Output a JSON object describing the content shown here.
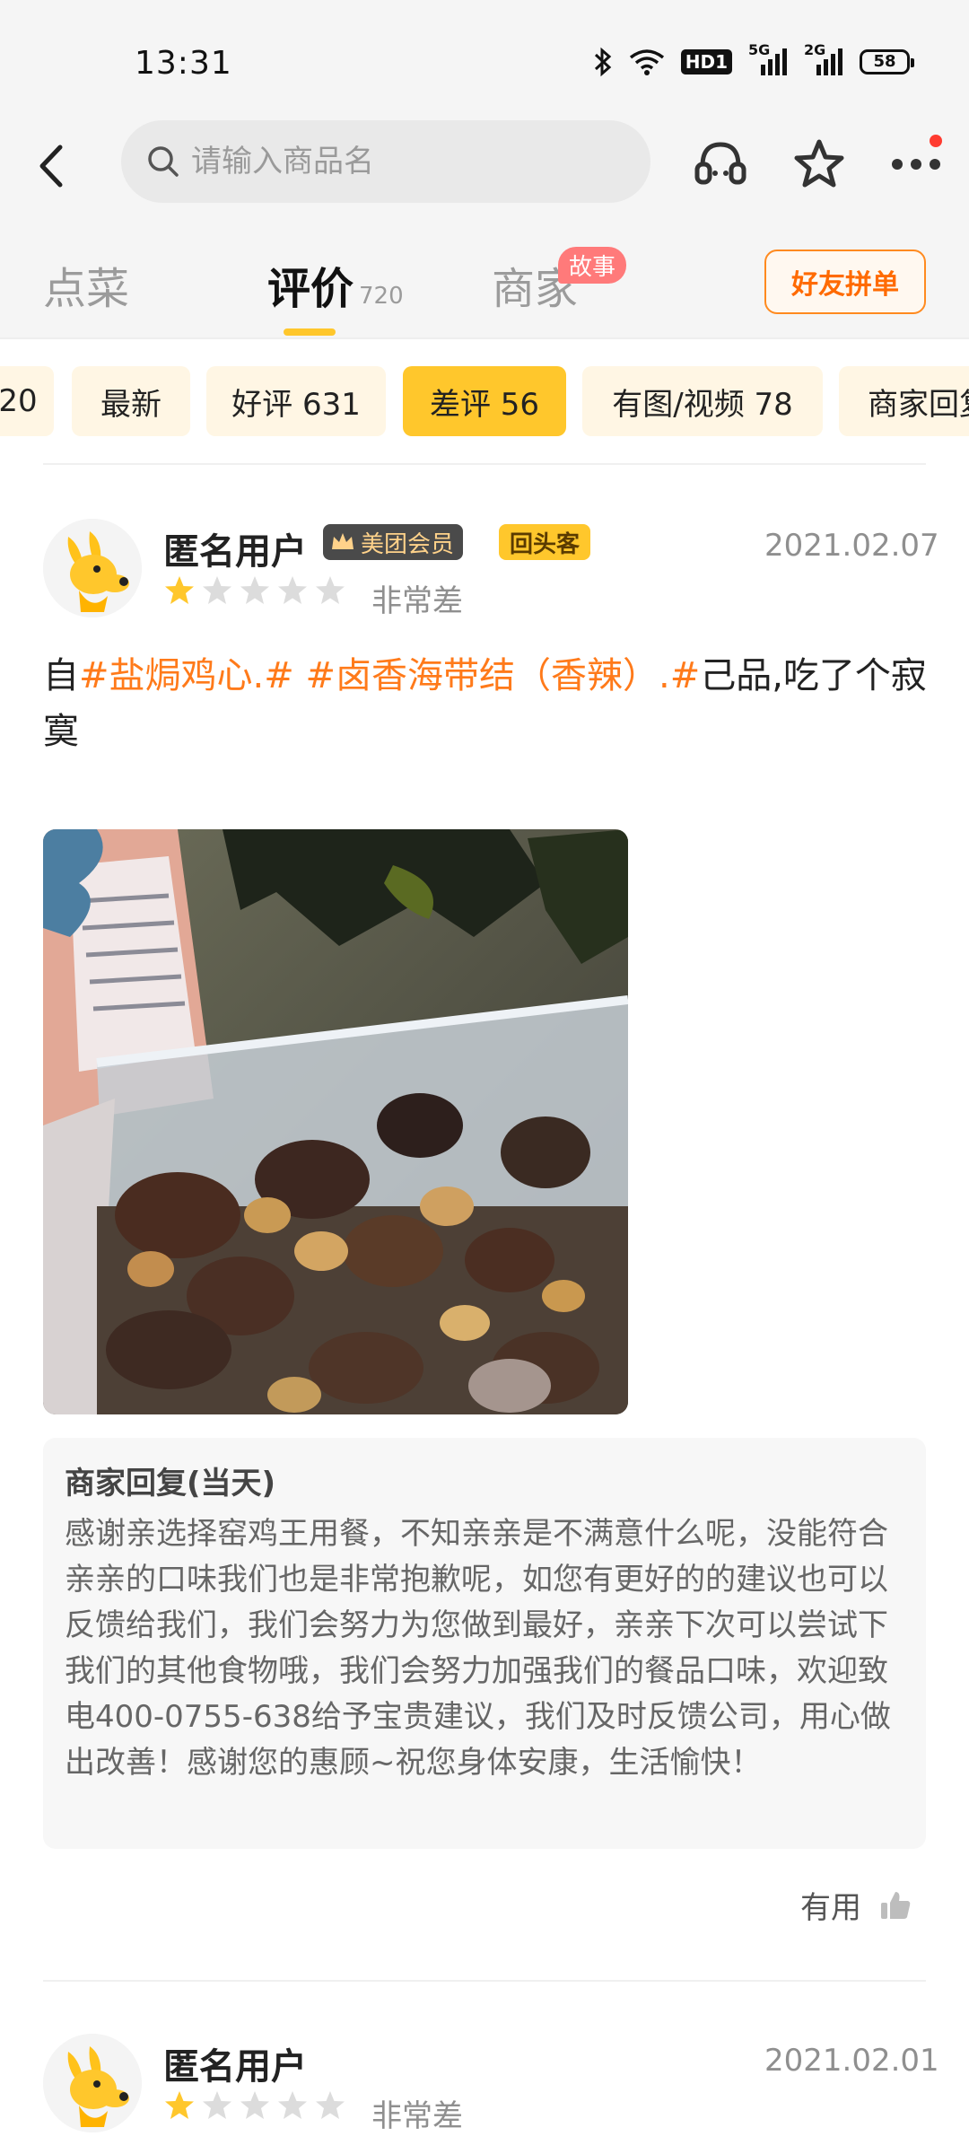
{
  "status_bar": {
    "time": "13:31",
    "hd_label": "HD1",
    "signal1_label": "5G",
    "signal2_label": "2G",
    "battery": "58"
  },
  "nav": {
    "search_placeholder": "请输入商品名"
  },
  "tabs": {
    "items": [
      {
        "label": "点菜"
      },
      {
        "label": "评价",
        "count": "720"
      },
      {
        "label": "商家",
        "badge": "故事"
      }
    ],
    "friend_button": "好友拼单"
  },
  "filters": [
    {
      "label": "20"
    },
    {
      "label": "最新"
    },
    {
      "label": "好评 631"
    },
    {
      "label": "差评 56"
    },
    {
      "label": "有图/视频 78"
    },
    {
      "label": "商家回复"
    }
  ],
  "reviews": [
    {
      "user": "匿名用户",
      "member_badge": "美团会员",
      "return_badge": "回头客",
      "date": "2021.02.07",
      "rating_stars": 1,
      "rating_text": "非常差",
      "text_prefix": "自",
      "tag1": "#盐焗鸡心.#",
      "tag2": "#卤香海带结（香辣）.#",
      "text_suffix": "己品,吃了个寂寞",
      "reply_title": "商家回复(当天)",
      "reply_text": "感谢亲选择窑鸡王用餐，不知亲亲是不满意什么呢，没能符合亲亲的口味我们也是非常抱歉呢，如您有更好的的建议也可以反馈给我们，我们会努力为您做到最好，亲亲下次可以尝试下我们的其他食物哦，我们会努力加强我们的餐品口味，欢迎致电400-0755-638给予宝贵建议，我们及时反馈公司，用心做出改善！感谢您的惠顾~祝您身体安康，生活愉快！",
      "useful_label": "有用"
    },
    {
      "user": "匿名用户",
      "date": "2021.02.01",
      "rating_stars": 1,
      "rating_text": "非常差"
    }
  ],
  "colors": {
    "accent": "#ffc72c",
    "tag": "#ff7a1a",
    "friend_button": "#ff6a00"
  }
}
